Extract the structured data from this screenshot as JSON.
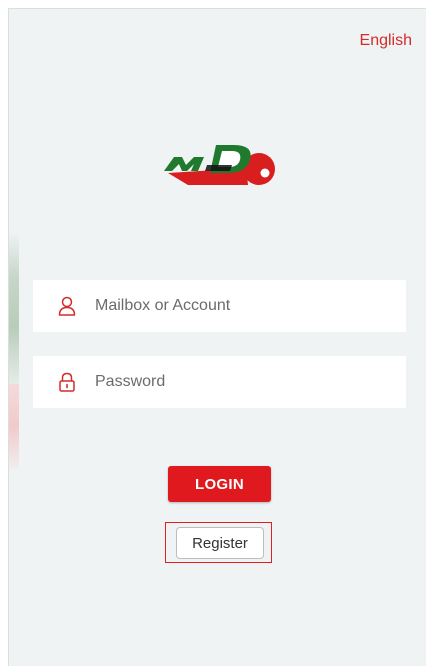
{
  "header": {
    "language_label": "English"
  },
  "brand": {
    "logo_text": "MD"
  },
  "form": {
    "account": {
      "placeholder": "Mailbox or Account",
      "icon": "user-icon"
    },
    "password": {
      "placeholder": "Password",
      "icon": "lock-icon"
    },
    "login_label": "LOGIN",
    "register_label": "Register"
  },
  "colors": {
    "accent_red": "#e0191e",
    "brand_green": "#1f7a2e",
    "background": "#eff3f4"
  }
}
